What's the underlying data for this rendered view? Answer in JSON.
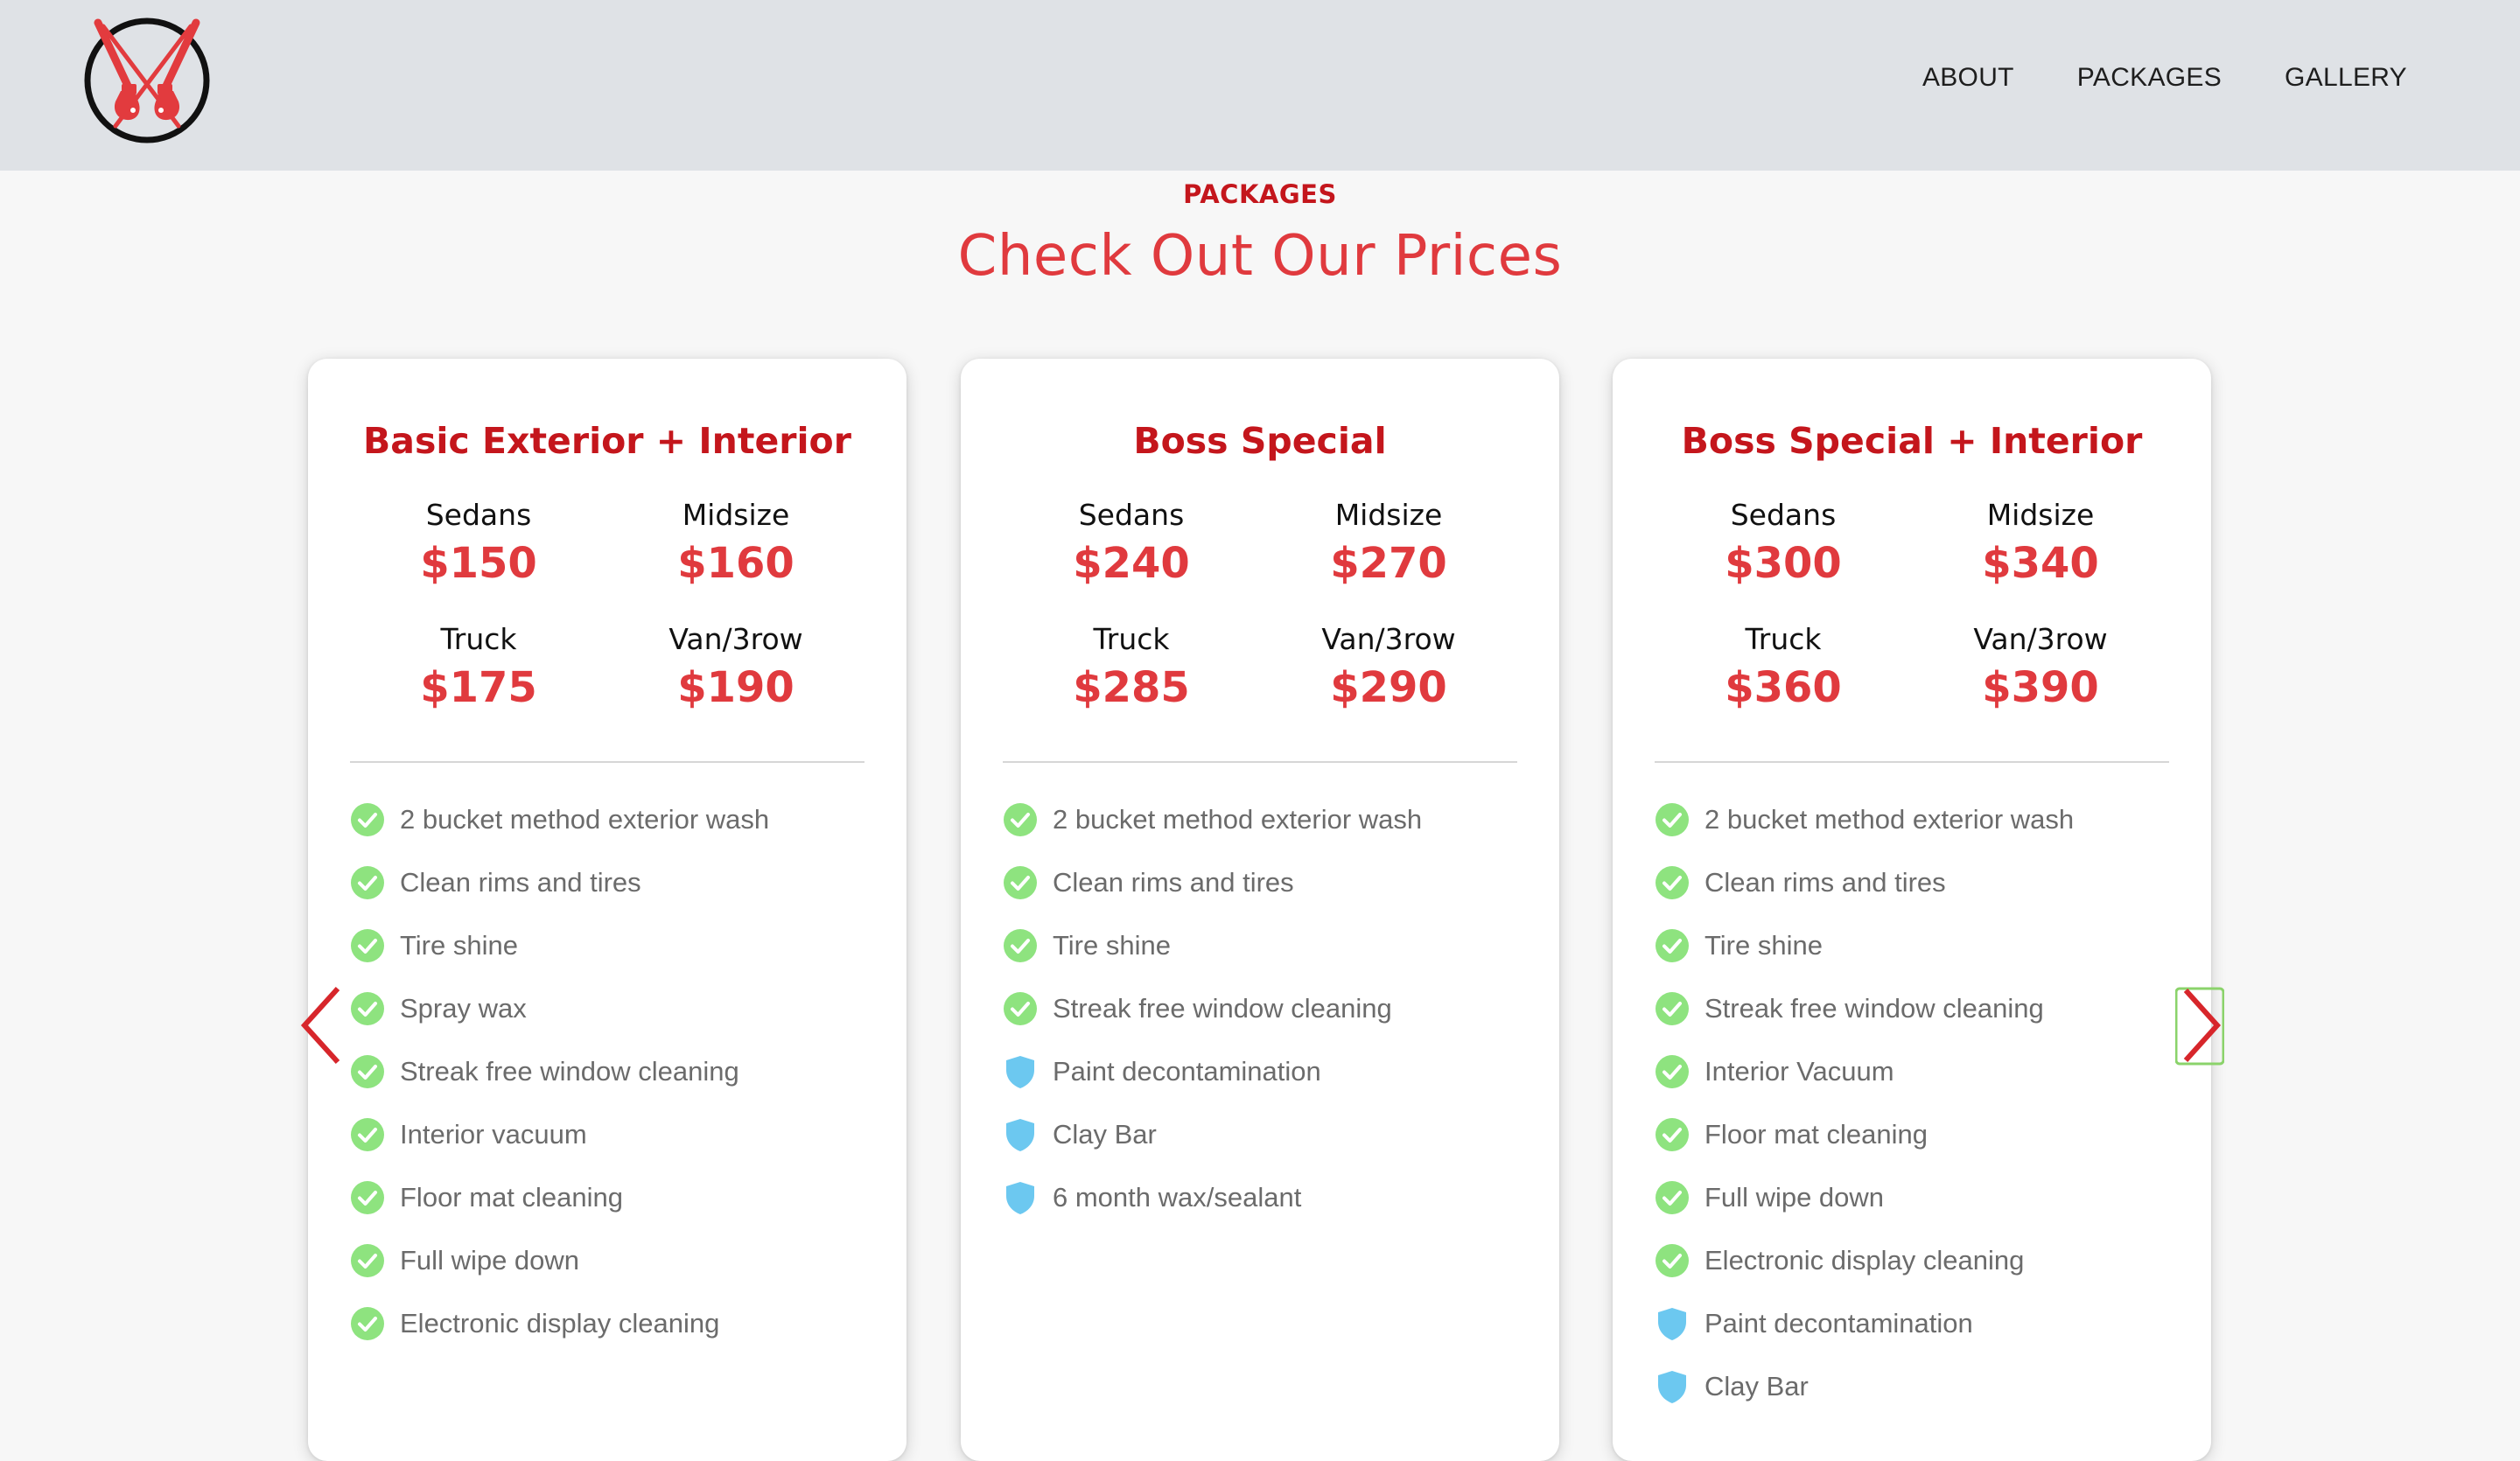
{
  "header": {
    "logo": "crossed-pump-nozzles-logo",
    "nav": [
      {
        "label": "ABOUT"
      },
      {
        "label": "PACKAGES"
      },
      {
        "label": "GALLERY"
      }
    ]
  },
  "section": {
    "eyebrow": "PACKAGES",
    "title": "Check Out Our Prices"
  },
  "colors": {
    "brand_red": "#c4161c",
    "price_red": "#e03a3e",
    "check_green": "#8ee37f",
    "shield_blue": "#6cc8f0",
    "header_bg": "#dfe2e6"
  },
  "cards": [
    {
      "title": "Basic Exterior + Interior",
      "prices": [
        {
          "label": "Sedans",
          "value": "$150"
        },
        {
          "label": "Midsize",
          "value": "$160"
        },
        {
          "label": "Truck",
          "value": "$175"
        },
        {
          "label": "Van/3row",
          "value": "$190"
        }
      ],
      "features": [
        {
          "text": "2 bucket method exterior wash",
          "icon": "check-icon"
        },
        {
          "text": "Clean rims and tires",
          "icon": "check-icon"
        },
        {
          "text": "Tire shine",
          "icon": "check-icon"
        },
        {
          "text": "Spray wax",
          "icon": "check-icon"
        },
        {
          "text": "Streak free window cleaning",
          "icon": "check-icon"
        },
        {
          "text": "Interior vacuum",
          "icon": "check-icon"
        },
        {
          "text": "Floor mat cleaning",
          "icon": "check-icon"
        },
        {
          "text": "Full wipe down",
          "icon": "check-icon"
        },
        {
          "text": "Electronic display cleaning",
          "icon": "check-icon"
        }
      ]
    },
    {
      "title": "Boss Special",
      "prices": [
        {
          "label": "Sedans",
          "value": "$240"
        },
        {
          "label": "Midsize",
          "value": "$270"
        },
        {
          "label": "Truck",
          "value": "$285"
        },
        {
          "label": "Van/3row",
          "value": "$290"
        }
      ],
      "features": [
        {
          "text": "2 bucket method exterior wash",
          "icon": "check-icon"
        },
        {
          "text": "Clean rims and tires",
          "icon": "check-icon"
        },
        {
          "text": "Tire shine",
          "icon": "check-icon"
        },
        {
          "text": "Streak free window cleaning",
          "icon": "check-icon"
        },
        {
          "text": "Paint decontamination",
          "icon": "shield-icon"
        },
        {
          "text": "Clay Bar",
          "icon": "shield-icon"
        },
        {
          "text": "6 month wax/sealant",
          "icon": "shield-icon"
        }
      ]
    },
    {
      "title": "Boss Special + Interior",
      "prices": [
        {
          "label": "Sedans",
          "value": "$300"
        },
        {
          "label": "Midsize",
          "value": "$340"
        },
        {
          "label": "Truck",
          "value": "$360"
        },
        {
          "label": "Van/3row",
          "value": "$390"
        }
      ],
      "features": [
        {
          "text": "2 bucket method exterior wash",
          "icon": "check-icon"
        },
        {
          "text": "Clean rims and tires",
          "icon": "check-icon"
        },
        {
          "text": "Tire shine",
          "icon": "check-icon"
        },
        {
          "text": "Streak free window cleaning",
          "icon": "check-icon"
        },
        {
          "text": "Interior Vacuum",
          "icon": "check-icon"
        },
        {
          "text": "Floor mat cleaning",
          "icon": "check-icon"
        },
        {
          "text": "Full wipe down",
          "icon": "check-icon"
        },
        {
          "text": "Electronic display cleaning",
          "icon": "check-icon"
        },
        {
          "text": "Paint decontamination",
          "icon": "shield-icon"
        },
        {
          "text": "Clay Bar",
          "icon": "shield-icon"
        }
      ]
    }
  ],
  "carousel": {
    "prev_icon": "chevron-left-icon",
    "next_icon": "chevron-right-icon"
  }
}
